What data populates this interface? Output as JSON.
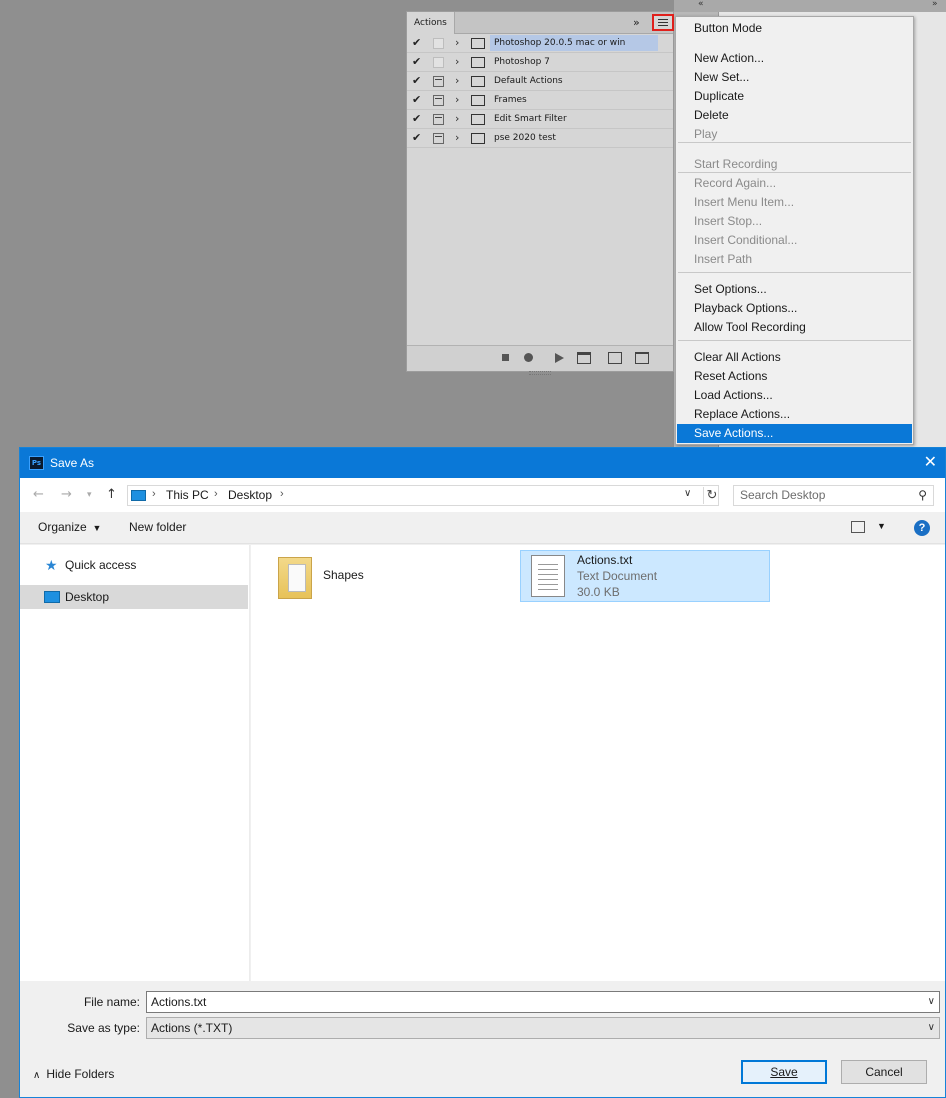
{
  "ps": {
    "actions_tab": "Actions",
    "expand_glyph": "»",
    "dock_collapse_left": "«",
    "dock_collapse_right": "»",
    "actions": [
      {
        "name": "Photoshop 20.0.5 mac or win",
        "enabled": true,
        "dialog": "empty",
        "selected": true
      },
      {
        "name": "Photoshop 7",
        "enabled": true,
        "dialog": "empty",
        "selected": false
      },
      {
        "name": "Default Actions",
        "enabled": true,
        "dialog": "on",
        "selected": false
      },
      {
        "name": "Frames",
        "enabled": true,
        "dialog": "on",
        "selected": false
      },
      {
        "name": "Edit Smart Filter",
        "enabled": true,
        "dialog": "on",
        "selected": false
      },
      {
        "name": "pse 2020 test",
        "enabled": true,
        "dialog": "on",
        "selected": false
      }
    ]
  },
  "menu": {
    "items": [
      {
        "label": "Button Mode",
        "disabled": false
      },
      {
        "label": "New Action...",
        "disabled": false
      },
      {
        "label": "New Set...",
        "disabled": false
      },
      {
        "label": "Duplicate",
        "disabled": false
      },
      {
        "label": "Delete",
        "disabled": false
      },
      {
        "label": "Play",
        "disabled": true
      },
      {
        "label": "Start Recording",
        "disabled": true
      },
      {
        "label": "Record Again...",
        "disabled": true
      },
      {
        "label": "Insert Menu Item...",
        "disabled": true
      },
      {
        "label": "Insert Stop...",
        "disabled": true
      },
      {
        "label": "Insert Conditional...",
        "disabled": true
      },
      {
        "label": "Insert Path",
        "disabled": true
      },
      {
        "label": "Set Options...",
        "disabled": false
      },
      {
        "label": "Playback Options...",
        "disabled": false
      },
      {
        "label": "Allow Tool Recording",
        "disabled": false
      },
      {
        "label": "Clear All Actions",
        "disabled": false
      },
      {
        "label": "Reset Actions",
        "disabled": false
      },
      {
        "label": "Load Actions...",
        "disabled": false
      },
      {
        "label": "Replace Actions...",
        "disabled": false
      },
      {
        "label": "Save Actions...",
        "disabled": false,
        "highlight": true
      }
    ]
  },
  "dialog": {
    "title": "Save As",
    "app_icon": "Ps",
    "breadcrumbs": [
      "This PC",
      "Desktop"
    ],
    "search_placeholder": "Search Desktop",
    "toolbar": {
      "organize": "Organize",
      "new_folder": "New folder"
    },
    "nav": [
      {
        "label": "Quick access",
        "selected": false
      },
      {
        "label": "Desktop",
        "selected": true
      }
    ],
    "files": {
      "folder": {
        "name": "Shapes"
      },
      "txt": {
        "name": "Actions.txt",
        "type": "Text Document",
        "size": "30.0 KB"
      }
    },
    "file_name_label": "File name:",
    "file_name_value": "Actions.txt",
    "save_type_label": "Save as type:",
    "save_type_value": "Actions (*.TXT)",
    "hide_folders": "Hide Folders",
    "save_button": "Save",
    "cancel_button": "Cancel"
  },
  "colors": {
    "accent": "#0a78d7",
    "selection": "#cce8ff",
    "ps_selection": "#b5c8e6",
    "highlight_border": "#e0201c"
  }
}
